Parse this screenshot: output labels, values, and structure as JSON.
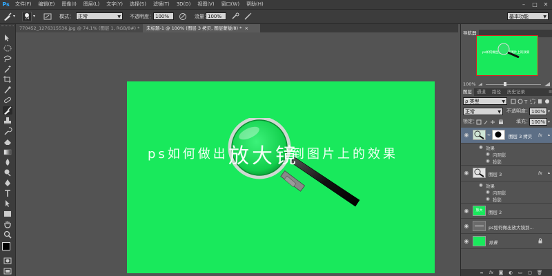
{
  "app": {
    "logo": "Ps"
  },
  "menu": [
    "文件(F)",
    "编辑(E)",
    "图像(I)",
    "图层(L)",
    "文字(Y)",
    "选择(S)",
    "滤镜(T)",
    "3D(D)",
    "视图(V)",
    "窗口(W)",
    "帮助(H)"
  ],
  "options": {
    "brush_size": "24",
    "mode_label": "模式：",
    "mode_value": "正常",
    "opacity_label": "不透明度：",
    "opacity_value": "100%",
    "flow_label": "流量：",
    "flow_value": "100%",
    "workspace": "基本功能"
  },
  "tabs": [
    {
      "label": "770452_1276315536.jpg @ 74.1% (图层 1, RGB/8#) *",
      "close": "×",
      "active": false
    },
    {
      "label": "未标题-1 @ 100% (图层 3 拷贝, 图层蒙版/8) *",
      "close": "×",
      "active": true
    }
  ],
  "canvas": {
    "text_left": "ps如何做出",
    "text_magnified": "放大镜",
    "text_right": "到图片上的效果",
    "background": "#19e95c"
  },
  "navigator": {
    "tab": "导航器",
    "zoom": "100%",
    "thumb_text": "ps如何做出放大镜到图片上的效果"
  },
  "layers_panel": {
    "tabs": [
      "图层",
      "通道",
      "路径",
      "历史记录"
    ],
    "filter_label": "ρ 类型",
    "blend_mode": "正常",
    "opacity_label": "不透明度：",
    "opacity_value": "100%",
    "lock_label": "锁定：",
    "fill_label": "填充：",
    "fill_value": "100%",
    "layers": [
      {
        "name": "图层 3 拷贝",
        "fx": "fx",
        "selected": true,
        "effects_label": "效果",
        "effects": [
          "内阴影",
          "投影"
        ]
      },
      {
        "name": "图层 3",
        "fx": "fx",
        "selected": false,
        "effects_label": "效果",
        "effects": [
          "内阴影",
          "投影"
        ]
      },
      {
        "name": "图层 2",
        "selected": false,
        "thumb_text": "放大"
      },
      {
        "name": "ps如何做出放大镜到...",
        "selected": false
      },
      {
        "name": "背景",
        "selected": false,
        "italic": true
      }
    ],
    "bottom_icons": [
      "link-icon",
      "fx-icon",
      "mask-icon",
      "adjustment-icon",
      "folder-icon",
      "new-layer-icon",
      "trash-icon"
    ]
  },
  "colors": {
    "accent": "#31a8ff",
    "canvas_green": "#19e95c",
    "panel_bg": "#535353",
    "bar_bg": "#3c3c3c",
    "selected_layer": "#5d6f86"
  }
}
